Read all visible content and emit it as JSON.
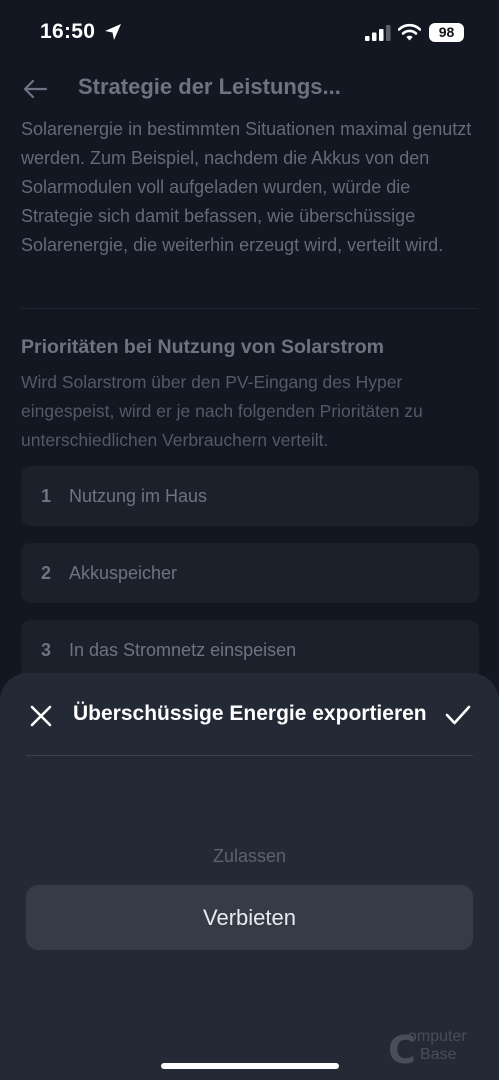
{
  "status_bar": {
    "time": "16:50",
    "battery": "98",
    "icons": [
      "location-arrow-icon",
      "cellular-signal-icon",
      "wifi-icon",
      "battery-icon"
    ]
  },
  "page": {
    "title": "Strategie der Leistungs...",
    "intro": "Solarenergie in bestimmten Situationen maximal genutzt werden. Zum Beispiel, nachdem die Akkus von den Solarmodulen voll aufgeladen wurden, würde die Strategie sich damit befassen, wie überschüssige Solarenergie, die weiterhin erzeugt wird, verteilt wird.",
    "section_title": "Prioritäten bei Nutzung von Solarstrom",
    "section_desc": "Wird Solarstrom über den PV-Eingang des Hyper eingespeist, wird er je nach folgenden Prioritäten zu unterschiedlichen Verbrauchern verteilt.",
    "priorities": [
      {
        "num": "1",
        "label": "Nutzung im Haus"
      },
      {
        "num": "2",
        "label": "Akkuspeicher"
      },
      {
        "num": "3",
        "label": "In das Stromnetz einspeisen"
      }
    ]
  },
  "sheet": {
    "title": "Überschüssige Energie exportieren",
    "options": [
      "Zulassen",
      "Verbieten"
    ],
    "selected": "Verbieten"
  },
  "watermark": {
    "line1": "omputer",
    "line2": "Base"
  },
  "colors": {
    "background": "#121722",
    "sheet": "#242a35",
    "selected_row": "#353b47"
  }
}
